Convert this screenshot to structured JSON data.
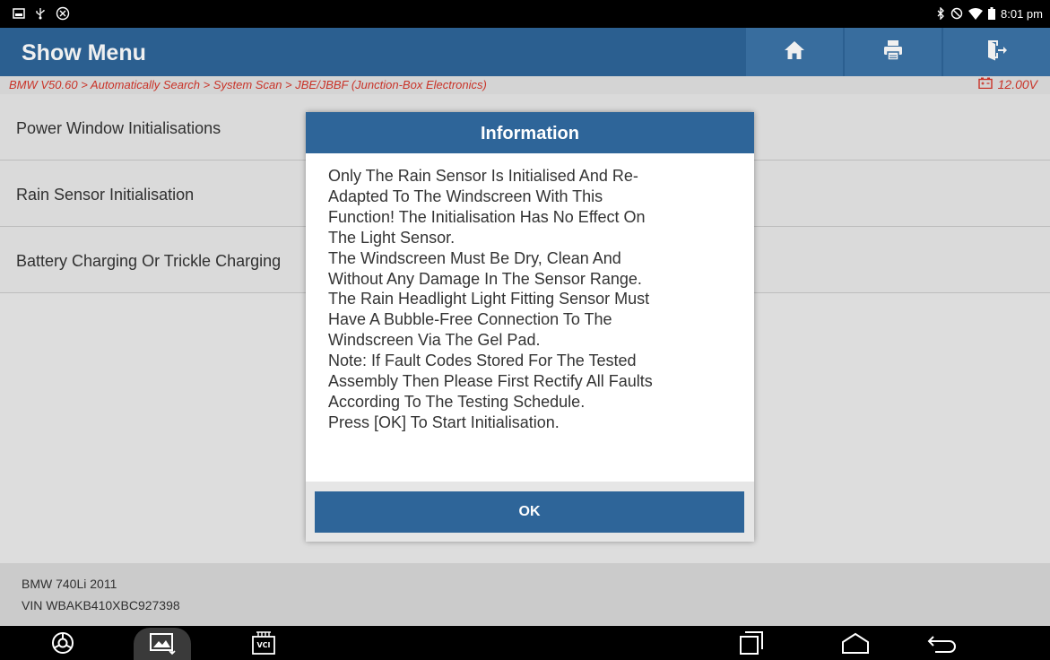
{
  "status_bar": {
    "time": "8:01 pm",
    "left_icons": [
      "screenshot-icon",
      "usb-icon",
      "target-icon"
    ],
    "right_icons": [
      "bluetooth-icon",
      "do-not-disturb-icon",
      "wifi-icon",
      "battery-icon"
    ]
  },
  "header": {
    "title": "Show Menu",
    "buttons": [
      "home-icon",
      "print-icon",
      "exit-icon"
    ]
  },
  "breadcrumb": {
    "path": "BMW V50.60 > Automatically Search > System Scan > JBE/JBBF (Junction-Box Electronics)",
    "voltage": "12.00V"
  },
  "menu": {
    "items": [
      {
        "label": "Power Window Initialisations"
      },
      {
        "label": "Rain Sensor Initialisation"
      },
      {
        "label": "Battery Charging Or Trickle Charging"
      }
    ]
  },
  "vehicle": {
    "model": "BMW 740Li 2011",
    "vin": "VIN WBAKB410XBC927398"
  },
  "dialog": {
    "title": "Information",
    "lines": [
      "Only The Rain Sensor Is Initialised And Re-",
      "Adapted To The Windscreen With This",
      "Function! The Initialisation Has No Effect On",
      "The Light Sensor.",
      "The Windscreen Must Be Dry, Clean And",
      "Without Any Damage In The Sensor Range.",
      "The Rain Headlight Light Fitting Sensor Must",
      "Have A Bubble-Free Connection To The",
      "Windscreen Via The Gel Pad.",
      "Note: If Fault Codes Stored For The Tested",
      "Assembly Then Please First Rectify All Faults",
      "According To The Testing Schedule.",
      "Press [OK] To Start Initialisation."
    ],
    "ok_label": "OK"
  },
  "nav_bar": {
    "vci_label": "VCI",
    "icons": [
      "browser-icon",
      "gallery-icon",
      "vci-icon",
      "recent-apps-icon",
      "home-nav-icon",
      "back-icon"
    ]
  },
  "colors": {
    "header_blue": "#2e6599",
    "header_button": "#3c74a8",
    "breadcrumb_red": "#d6362a",
    "background": "#ebebeb"
  }
}
